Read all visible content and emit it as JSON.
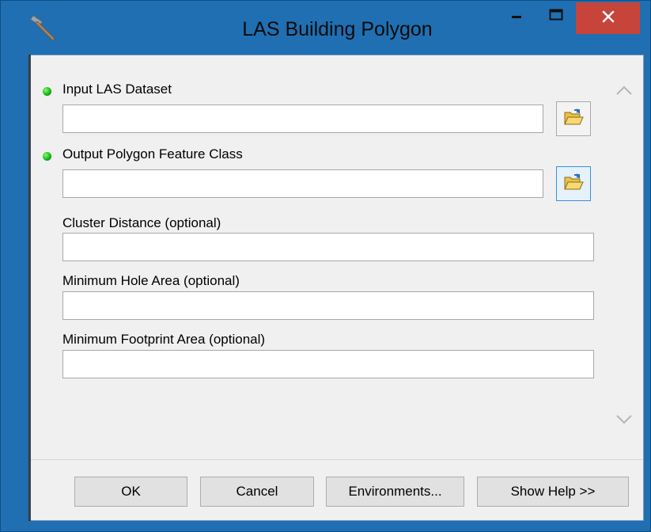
{
  "window": {
    "title": "LAS Building Polygon",
    "icon": "hammer-icon",
    "controls": {
      "minimize": "minimize-icon",
      "maximize": "maximize-icon",
      "close": "close-icon"
    }
  },
  "params": [
    {
      "label": "Input LAS Dataset",
      "required": true,
      "value": "",
      "browse": true
    },
    {
      "label": "Output Polygon Feature Class",
      "required": true,
      "value": "",
      "browse": true
    },
    {
      "label": "Cluster Distance (optional)",
      "required": false,
      "value": "",
      "browse": false
    },
    {
      "label": "Minimum Hole Area (optional)",
      "required": false,
      "value": "",
      "browse": false
    },
    {
      "label": "Minimum Footprint Area (optional)",
      "required": false,
      "value": "",
      "browse": false
    }
  ],
  "buttons": {
    "ok": "OK",
    "cancel": "Cancel",
    "environments": "Environments...",
    "show_help": "Show Help >>"
  },
  "colors": {
    "titlebar": "#1f6fb2",
    "close": "#c7443a",
    "required_dot": "#10b010",
    "panel": "#f0f0f0"
  }
}
